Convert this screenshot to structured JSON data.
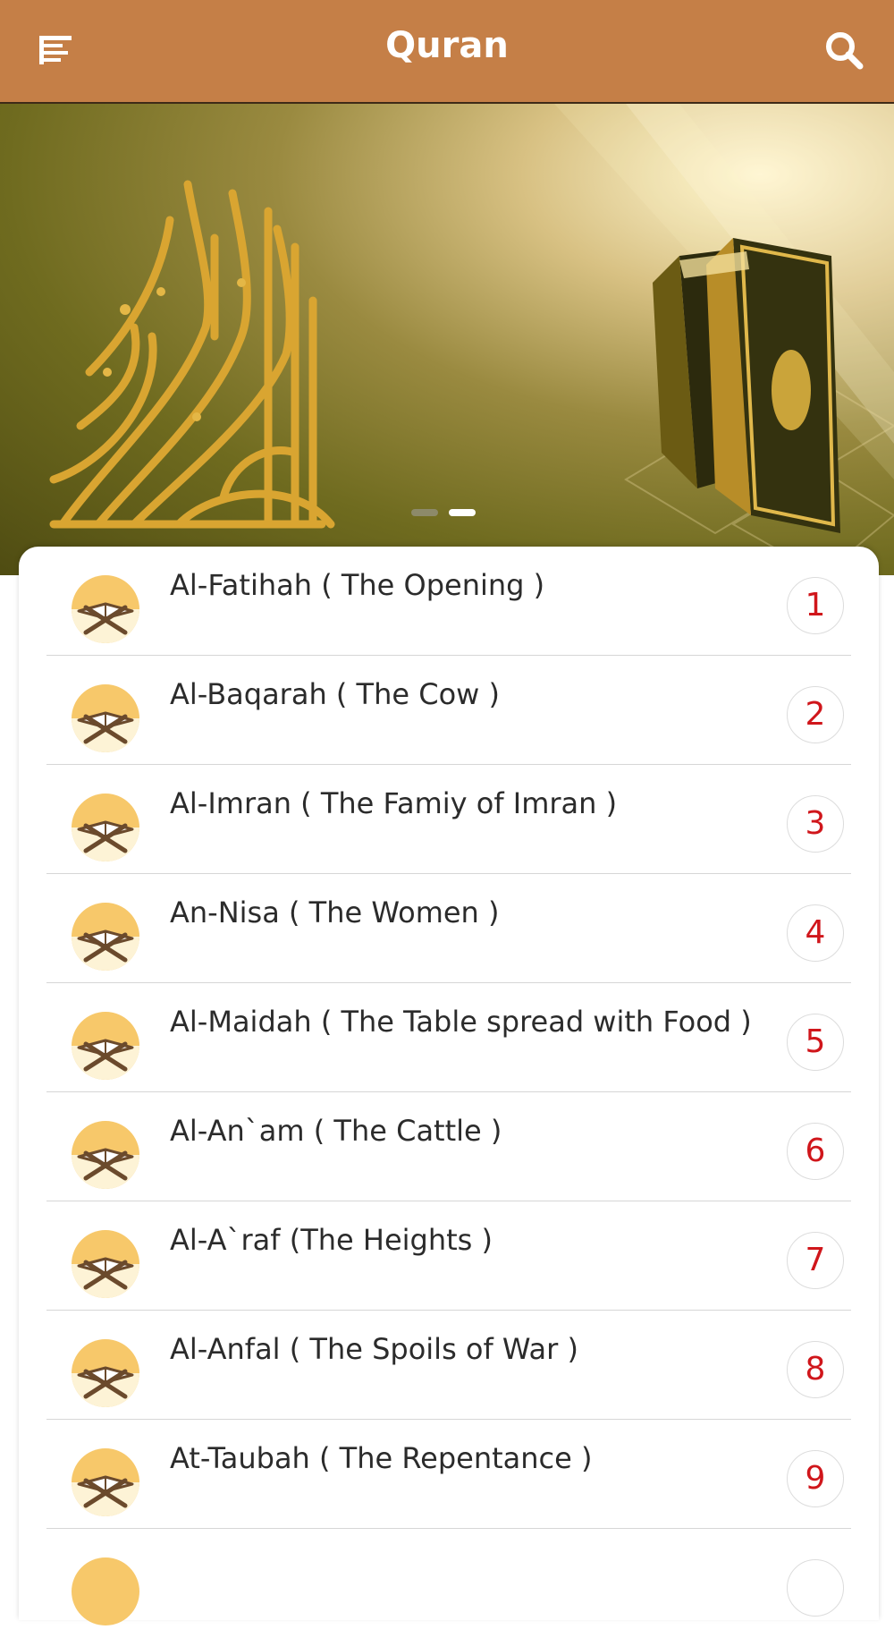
{
  "app": {
    "title": "Quran",
    "menu_icon": "menu-lines-icon",
    "search_icon": "search-icon",
    "accent_color": "#c57f47",
    "number_color": "#d0161b"
  },
  "banner": {
    "carousel": {
      "slides": 2,
      "active_index": 1
    }
  },
  "surahs": [
    {
      "name": "Al-Fatihah ( The Opening )",
      "number": "1"
    },
    {
      "name": "Al-Baqarah ( The Cow )",
      "number": "2"
    },
    {
      "name": "Al-Imran ( The Famiy of Imran )",
      "number": "3"
    },
    {
      "name": "An-Nisa ( The Women )",
      "number": "4"
    },
    {
      "name": "Al-Maidah ( The Table spread with Food )",
      "number": "5"
    },
    {
      "name": "Al-An`am ( The Cattle )",
      "number": "6"
    },
    {
      "name": "Al-A`raf (The Heights )",
      "number": "7"
    },
    {
      "name": "Al-Anfal ( The Spoils of War )",
      "number": "8"
    },
    {
      "name": "At-Taubah ( The Repentance )",
      "number": "9"
    }
  ]
}
